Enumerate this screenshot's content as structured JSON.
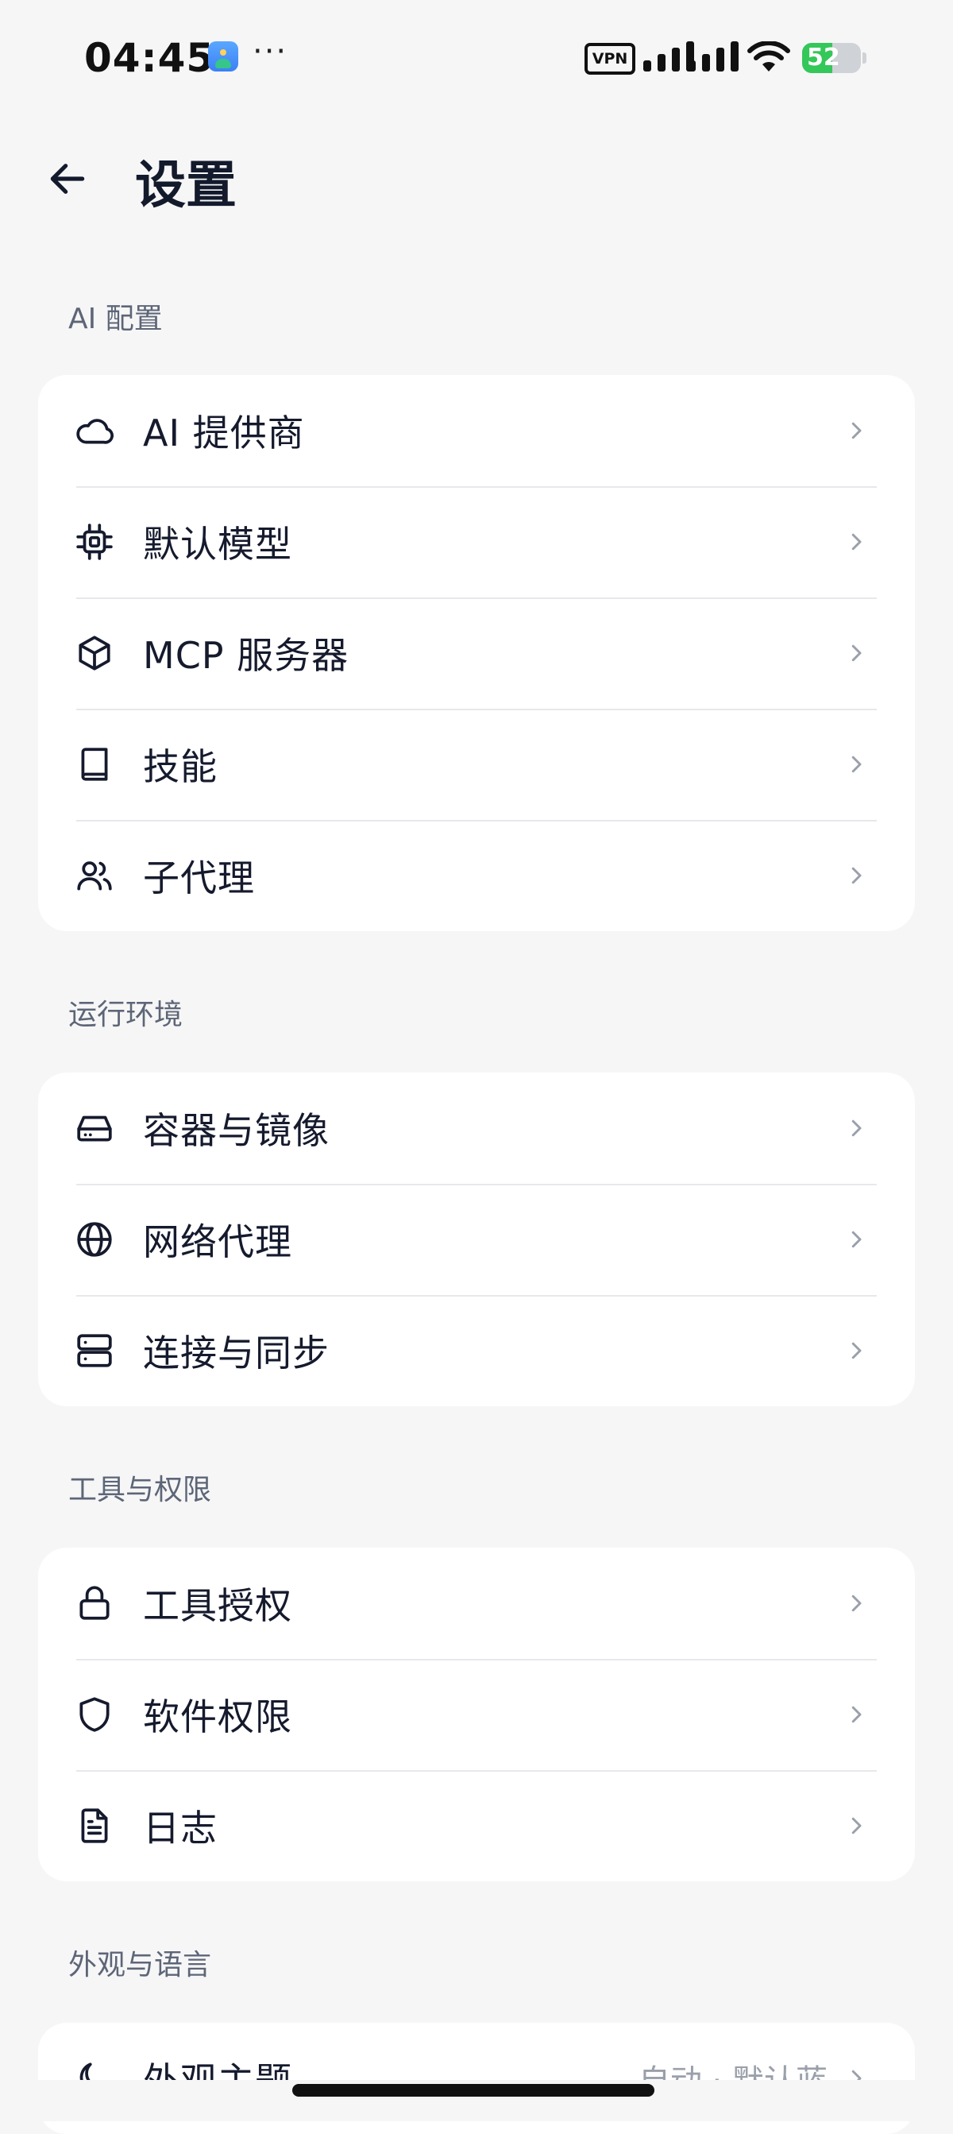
{
  "status_bar": {
    "time": "04:45",
    "more": "···",
    "vpn": "VPN",
    "battery": "52",
    "battery_level": 0.52
  },
  "header": {
    "title": "设置"
  },
  "sections": [
    {
      "label": "AI 配置",
      "items": [
        {
          "label": "AI 提供商",
          "icon": "cloud-icon"
        },
        {
          "label": "默认模型",
          "icon": "chip-icon"
        },
        {
          "label": "MCP 服务器",
          "icon": "cube-icon"
        },
        {
          "label": "技能",
          "icon": "book-icon"
        },
        {
          "label": "子代理",
          "icon": "users-icon"
        }
      ]
    },
    {
      "label": "运行环境",
      "items": [
        {
          "label": "容器与镜像",
          "icon": "hard-drive-icon"
        },
        {
          "label": "网络代理",
          "icon": "globe-icon"
        },
        {
          "label": "连接与同步",
          "icon": "server-icon"
        }
      ]
    },
    {
      "label": "工具与权限",
      "items": [
        {
          "label": "工具授权",
          "icon": "lock-icon"
        },
        {
          "label": "软件权限",
          "icon": "shield-icon"
        },
        {
          "label": "日志",
          "icon": "file-text-icon"
        }
      ]
    },
    {
      "label": "外观与语言",
      "items": [
        {
          "label": "外观主题",
          "value": "自动 · 默认蓝",
          "icon": "moon-icon"
        }
      ]
    }
  ]
}
